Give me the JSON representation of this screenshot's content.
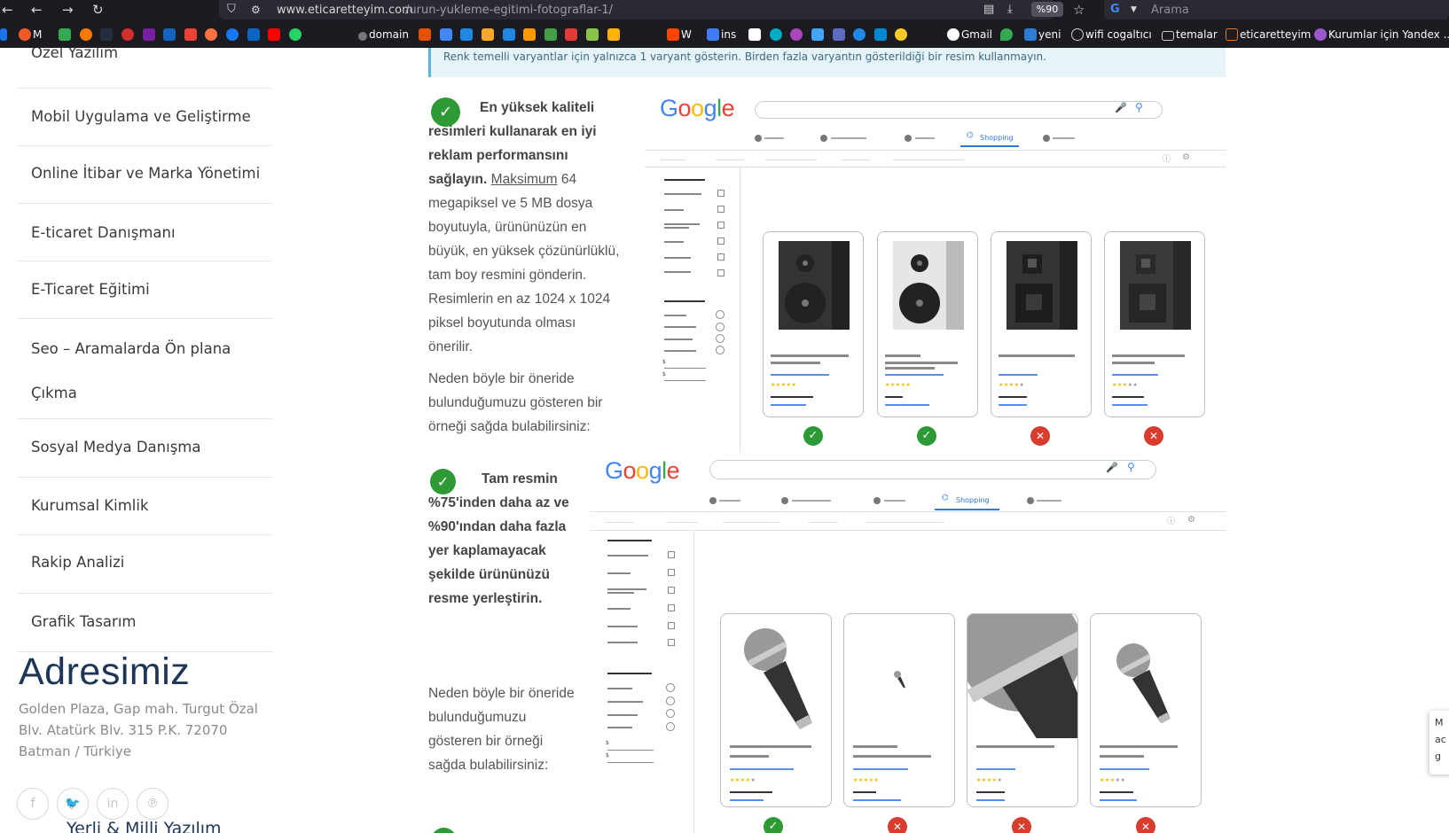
{
  "browser": {
    "url_host": "www.eticaretteyim.com",
    "url_path": "/urun-yukleme-egitimi-fotograflar-1/",
    "zoom": "%90",
    "search_placeholder": "Arama"
  },
  "bookmarks": [
    {
      "label": "M",
      "color": "#f05a28"
    },
    {
      "label": "domain",
      "color": "#888888"
    },
    {
      "label": "W",
      "color": "#ff4400"
    },
    {
      "label": "ins",
      "color": "#3d7bf7"
    },
    {
      "label": "Gmail",
      "color": "#ea4335"
    },
    {
      "label": "yeni",
      "color": "#2c7bd5"
    },
    {
      "label": "wifi cogaltıcı",
      "color": "#aaaaaa"
    },
    {
      "label": "temalar",
      "color": "#aaaaaa"
    },
    {
      "label": "eticaretteyim",
      "color": "#e07a2a"
    },
    {
      "label": "Kurumlar için Yandex ...",
      "color": "#9b59d0"
    }
  ],
  "sidebar": {
    "items": [
      "Özel Yazılım",
      "Mobil Uygulama ve Geliştirme",
      "Online İtibar ve Marka Yönetimi",
      "E-ticaret Danışmanı",
      "E-Ticaret Eğitimi",
      "Seo – Aramalarda Ön plana",
      "Çıkma",
      "Sosyal Medya Danışma",
      "Kurumsal Kimlik",
      "Rakip Analizi",
      "Grafik Tasarım"
    ]
  },
  "address": {
    "title": "Adresimiz",
    "text": "Golden Plaza, Gap mah. Turgut Özal Blv. Atatürk Blv. 315 P.K. 72070 Batman / Türkiye",
    "footer_line": "Yerli & Milli Yazılım"
  },
  "social_icons": [
    "facebook-icon",
    "twitter-icon",
    "linkedin-icon",
    "pinterest-icon"
  ],
  "notice": "Renk temelli varyantlar için yalnızca 1 varyant gösterin. Birden fazla varyantın gösterildiği bir resim kullanmayın.",
  "section1": {
    "bold": "En yüksek kaliteli resimleri kullanarak en iyi reklam performansını sağlayın.",
    "link": "Maksimum",
    "rest": " 64 megapiksel ve 5 MB dosya boyutuyla, ürününüzün en büyük, en yüksek çözünürlüklü, tam boy resmini gönderin. Resimlerin en az 1024 x 1024 piksel boyutunda olması önerilir.",
    "note": "Neden böyle bir öneride bulunduğumuzu gösteren bir örneği sağda bulabilirsiniz:"
  },
  "section2": {
    "bold": "Tam resmin %75'inden daha az ve %90'ından daha fazla yer kaplamayacak şekilde ürününüzü resme yerleştirin.",
    "note": "Neden böyle bir öneride bulunduğumuzu gösteren bir örneği sağda bulabilirsiniz:"
  },
  "mock": {
    "logo": [
      "G",
      "o",
      "o",
      "g",
      "l",
      "e"
    ],
    "logo_colors": [
      "#4285f4",
      "#ea4335",
      "#fbbc05",
      "#4285f4",
      "#34a853",
      "#ea4335"
    ],
    "shopping_tab": "Shopping",
    "section1_results": [
      "ok",
      "ok",
      "no",
      "no"
    ],
    "section2_results": [
      "ok",
      "no",
      "no",
      "no"
    ],
    "ok_symbol": "✓",
    "no_symbol": "✕"
  },
  "side_popup": [
    "M",
    "ac",
    "g"
  ]
}
